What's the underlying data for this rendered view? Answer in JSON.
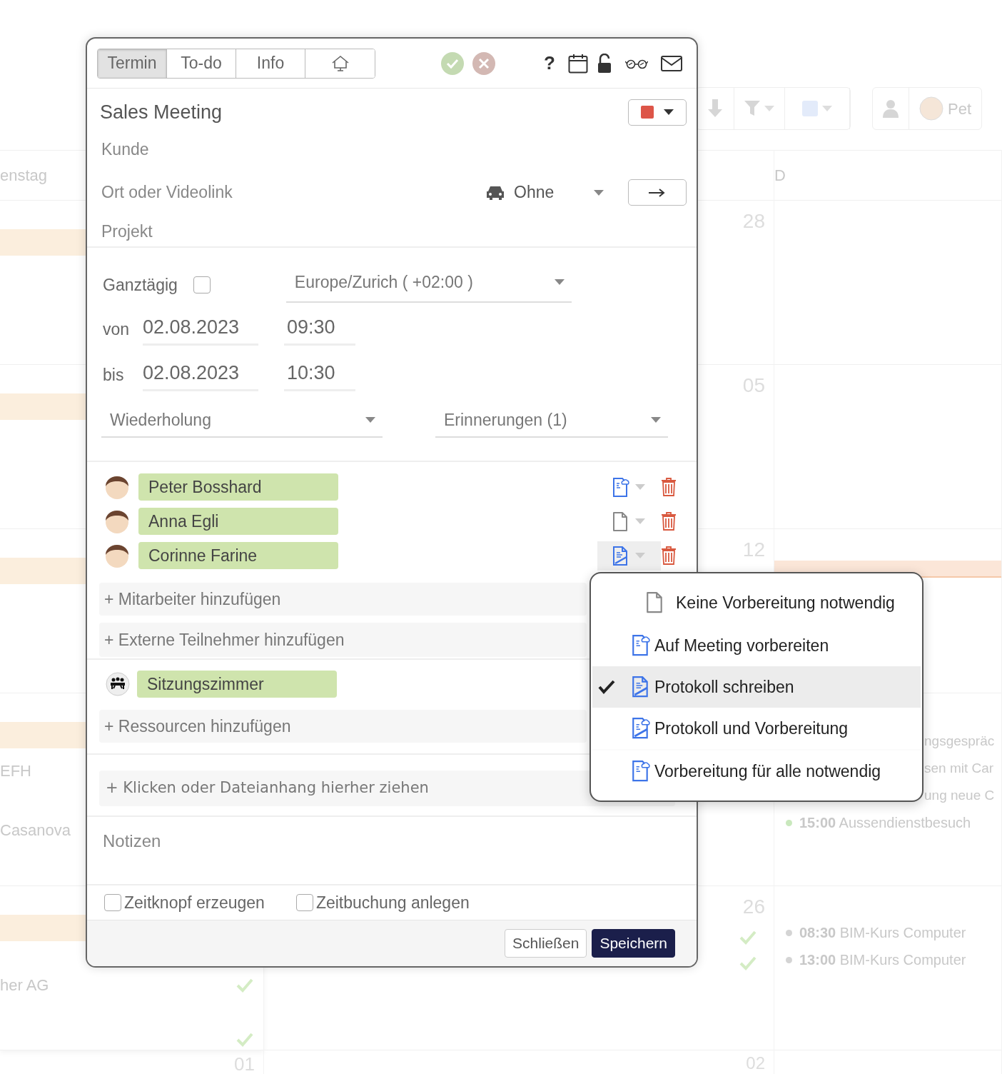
{
  "calendar": {
    "toolbar_user": "Pet",
    "headers": [
      "enstag",
      "D"
    ],
    "day_numbers": [
      "28",
      "05",
      "12",
      "26",
      "02"
    ],
    "left_day_number": "01",
    "left_texts": [
      "EFH",
      "Casanova",
      "her AG"
    ],
    "events": [
      {
        "text": "ngsgespräc"
      },
      {
        "text": "sen mit Car"
      },
      {
        "text": "ung neue C"
      }
    ],
    "timed_events": [
      {
        "time": "15:00",
        "title": "Aussendienstbesuch",
        "color": "#c9e8bd"
      },
      {
        "time": "08:30",
        "title": "BIM-Kurs Computer",
        "color": "#d4d4d4"
      },
      {
        "time": "13:00",
        "title": "BIM-Kurs Computer",
        "color": "#d4d4d4"
      }
    ]
  },
  "dialog": {
    "tabs": [
      {
        "kind": "text",
        "label": "Termin",
        "selected": true
      },
      {
        "kind": "text",
        "label": "To-do",
        "selected": false
      },
      {
        "kind": "text",
        "label": "Info",
        "selected": false
      },
      {
        "kind": "home",
        "selected": false
      }
    ],
    "help": "?",
    "title": "Sales Meeting",
    "color": "#dd5548",
    "customer": {
      "placeholder": "Kunde"
    },
    "location": {
      "placeholder": "Ort oder Videolink"
    },
    "travel_mode": "Ohne",
    "project": {
      "placeholder": "Projekt"
    },
    "all_day": {
      "label": "Ganztägig",
      "checked": false
    },
    "timezone": "Europe/Zurich ( +02:00 )",
    "from": {
      "label": "von",
      "date": "02.08.2023",
      "time": "09:30"
    },
    "to": {
      "label": "bis",
      "date": "02.08.2023",
      "time": "10:30"
    },
    "recurrence": "Wiederholung",
    "reminders": "Erinnerungen (1)",
    "participants": [
      {
        "kind": "prepare",
        "name": "Peter Bosshard",
        "menu_open": false
      },
      {
        "kind": "none",
        "name": "Anna Egli",
        "menu_open": false
      },
      {
        "kind": "protocol",
        "name": "Corinne Farine",
        "menu_open": true
      }
    ],
    "add_employee": "+ Mitarbeiter hinzufügen",
    "add_external": "+ Externe Teilnehmer hinzufügen",
    "resources": [
      {
        "name": "Sitzungszimmer"
      }
    ],
    "add_resource": "+ Ressourcen hinzufügen",
    "attachment": "+ Klicken oder Dateianhang hierher ziehen",
    "notes": {
      "placeholder": "Notizen"
    },
    "options": [
      {
        "label": "Zeitknopf erzeugen",
        "checked": false
      },
      {
        "label": "Zeitbuchung anlegen",
        "checked": false
      }
    ],
    "buttons": [
      {
        "kind": "secondary",
        "label": "Schließen"
      },
      {
        "kind": "primary",
        "label": "Speichern"
      }
    ]
  },
  "prep_menu": {
    "items": [
      {
        "kind": "none",
        "label": "Keine Vorbereitung notwendig",
        "selected": false
      },
      {
        "kind": "prepare",
        "label": "Auf Meeting vorbereiten",
        "selected": false
      },
      {
        "kind": "protocol",
        "label": "Protokoll schreiben",
        "selected": true
      },
      {
        "kind": "both",
        "label": "Protokoll und Vorbereitung",
        "selected": false
      },
      {
        "kind": "prepare",
        "label": "Vorbereitung für alle notwendig",
        "selected": false
      }
    ]
  }
}
